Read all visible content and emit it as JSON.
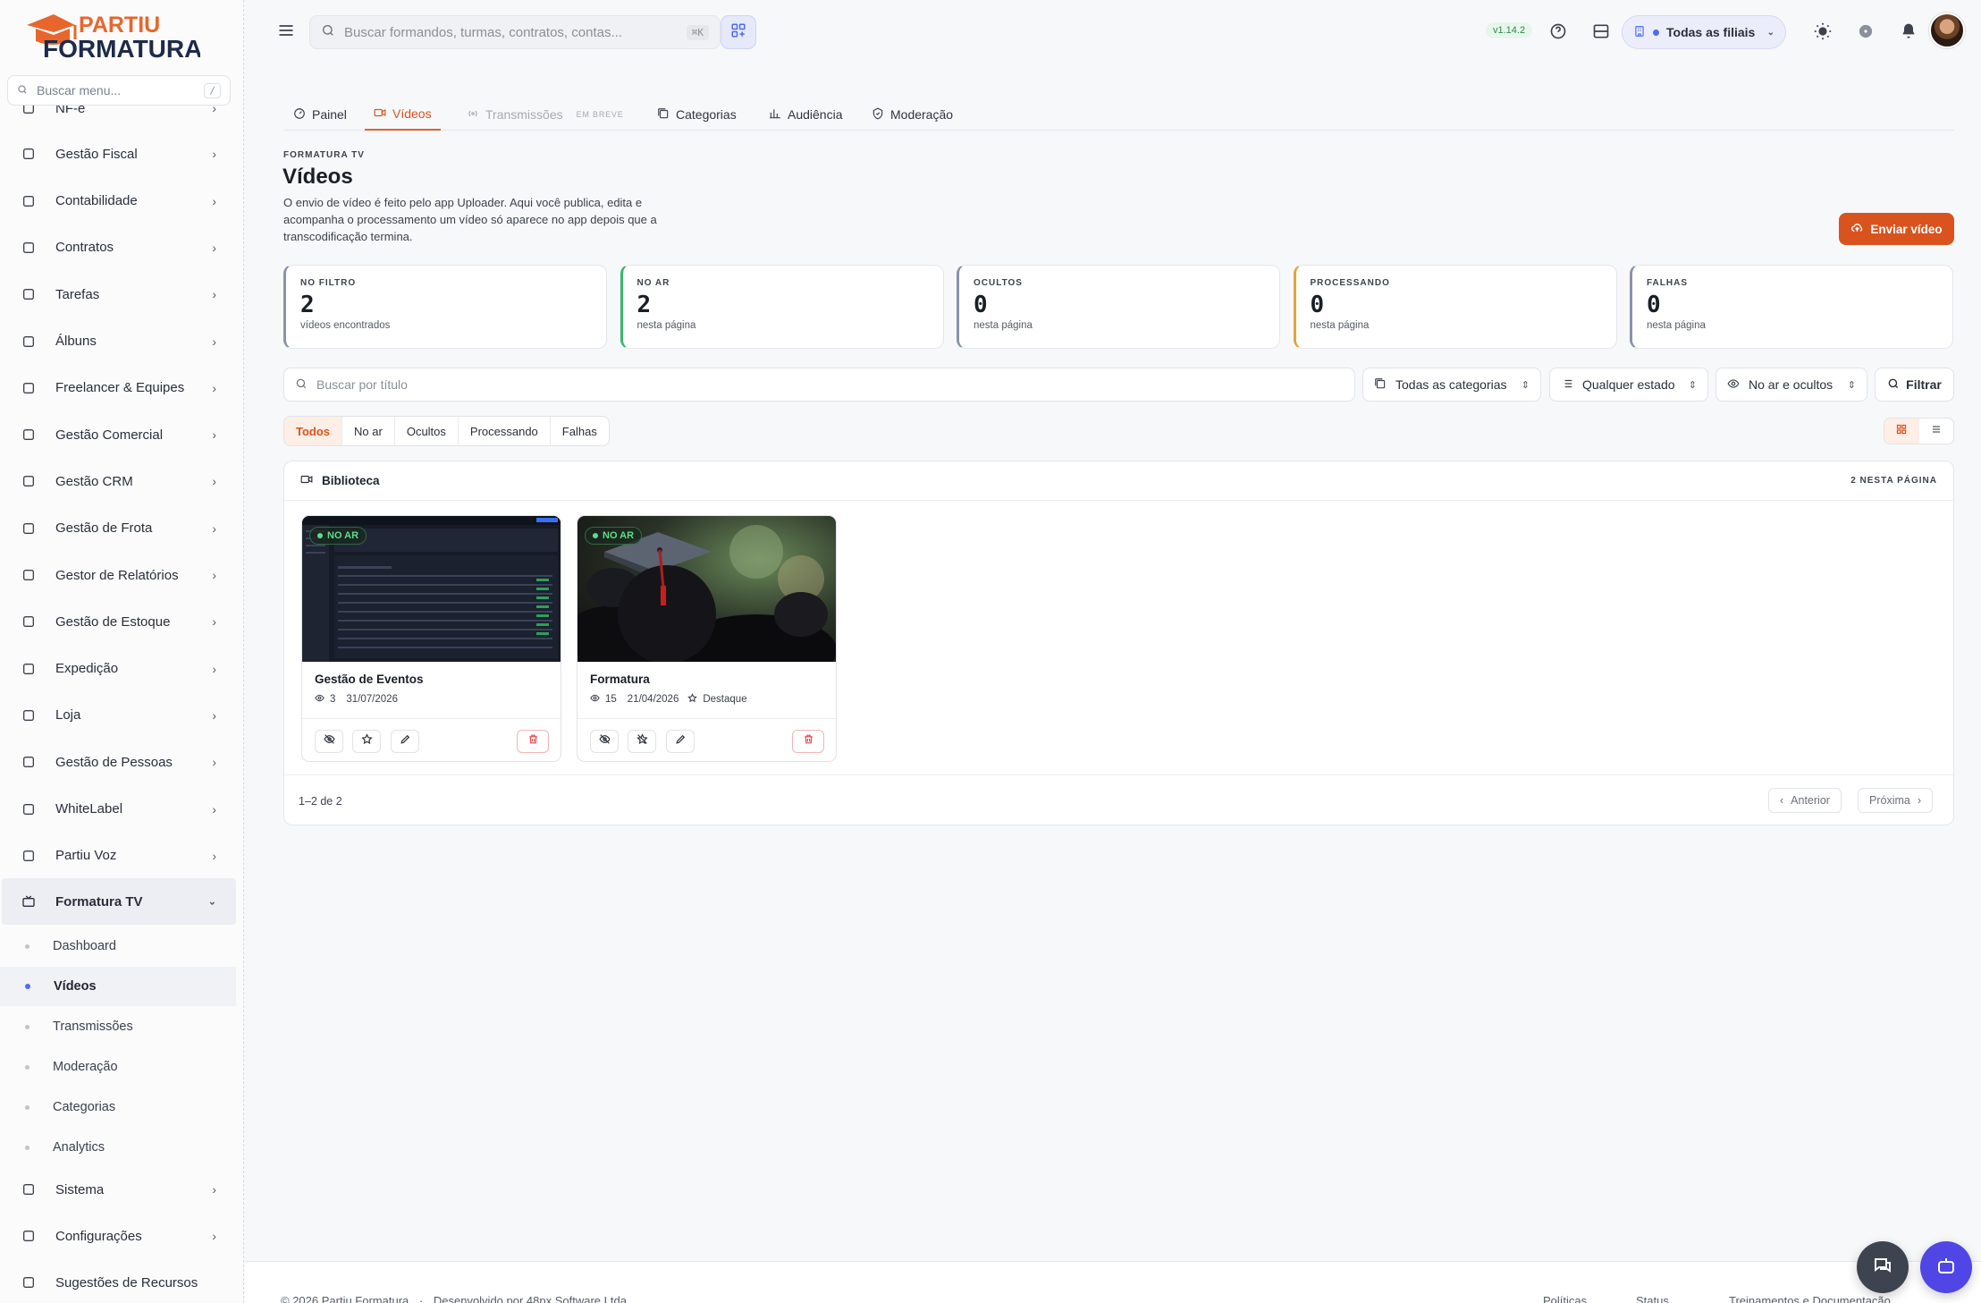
{
  "brand": {
    "line1": "PARTIU",
    "line2": "FORMATURA"
  },
  "menu_search": {
    "placeholder": "Buscar menu...",
    "shortcut": "/"
  },
  "nav": {
    "items": [
      {
        "label": "NF-e",
        "icon": "chevron-right-icon"
      },
      {
        "label": "Gestão Fiscal",
        "icon": "receipt-icon"
      },
      {
        "label": "Contabilidade",
        "icon": "book-icon"
      },
      {
        "label": "Contratos",
        "icon": "file-icon"
      },
      {
        "label": "Tarefas",
        "icon": "checkbox-icon"
      },
      {
        "label": "Álbuns",
        "icon": "album-icon"
      },
      {
        "label": "Freelancer & Equipes",
        "icon": "team-icon"
      },
      {
        "label": "Gestão Comercial",
        "icon": "briefcase-icon"
      },
      {
        "label": "Gestão CRM",
        "icon": "chart-icon"
      },
      {
        "label": "Gestão de Frota",
        "icon": "truck-icon"
      },
      {
        "label": "Gestor de Relatórios",
        "icon": "report-icon"
      },
      {
        "label": "Gestão de Estoque",
        "icon": "box-icon"
      },
      {
        "label": "Expedição",
        "icon": "package-icon"
      },
      {
        "label": "Loja",
        "icon": "cart-icon"
      },
      {
        "label": "Gestão de Pessoas",
        "icon": "users-icon"
      },
      {
        "label": "WhiteLabel",
        "icon": "palette-icon"
      },
      {
        "label": "Partiu Voz",
        "icon": "phone-icon"
      }
    ],
    "open_section": {
      "label": "Formatura TV",
      "icon": "tv-icon"
    },
    "sub_items": [
      {
        "label": "Dashboard"
      },
      {
        "label": "Vídeos"
      },
      {
        "label": "Transmissões"
      },
      {
        "label": "Moderação"
      },
      {
        "label": "Categorias"
      },
      {
        "label": "Analytics"
      }
    ],
    "bottom_items": [
      {
        "label": "Sistema",
        "icon": "layers-icon"
      },
      {
        "label": "Configurações",
        "icon": "gear-icon"
      },
      {
        "label": "Sugestões de Recursos",
        "icon": "lightbulb-icon"
      }
    ]
  },
  "topbar": {
    "search_placeholder": "Buscar formandos, turmas, contratos, contas...",
    "search_shortcut": "⌘K",
    "version": "v1.14.2",
    "branch": "Todas as filiais"
  },
  "tabs": [
    {
      "label": "Painel"
    },
    {
      "label": "Vídeos"
    },
    {
      "label": "Transmissões",
      "badge": "EM BREVE"
    },
    {
      "label": "Categorias"
    },
    {
      "label": "Audiência"
    },
    {
      "label": "Moderação"
    }
  ],
  "page": {
    "eyebrow": "FORMATURA TV",
    "title": "Vídeos",
    "description": "O envio de vídeo é feito pelo app Uploader. Aqui você publica, edita e acompanha o processamento um vídeo só aparece no app depois que a transcodificação termina.",
    "send_button": "Enviar vídeo"
  },
  "stats": [
    {
      "label": "NO FILTRO",
      "value": "2",
      "sub": "vídeos encontrados",
      "color": "#8a93a6"
    },
    {
      "label": "NO AR",
      "value": "2",
      "sub": "nesta página",
      "color": "#3cb371"
    },
    {
      "label": "OCULTOS",
      "value": "0",
      "sub": "nesta página",
      "color": "#8a93a6"
    },
    {
      "label": "PROCESSANDO",
      "value": "0",
      "sub": "nesta página",
      "color": "#e3a33b"
    },
    {
      "label": "FALHAS",
      "value": "0",
      "sub": "nesta página",
      "color": "#8a93a6"
    }
  ],
  "filters": {
    "search_placeholder": "Buscar por título",
    "category": "Todas as categorias",
    "state": "Qualquer estado",
    "visibility": "No ar e ocultos",
    "filter_button": "Filtrar"
  },
  "segments": [
    "Todos",
    "No ar",
    "Ocultos",
    "Processando",
    "Falhas"
  ],
  "library": {
    "title": "Biblioteca",
    "count": "2 NESTA PÁGINA",
    "videos": [
      {
        "title": "Gestão de Eventos",
        "status": "NO AR",
        "views": "3",
        "date": "31/07/2026",
        "featured": ""
      },
      {
        "title": "Formatura",
        "status": "NO AR",
        "views": "15",
        "date": "21/04/2026",
        "featured": "Destaque"
      }
    ],
    "range": "1–2 de 2",
    "prev": "Anterior",
    "next": "Próxima"
  },
  "footer": {
    "copyright": "© 2026 Partiu Formatura",
    "developed": "Desenvolvido por 48px Software Ltda",
    "links": [
      "Políticas",
      "Status",
      "Treinamentos e Documentação"
    ]
  },
  "colors": {
    "accent": "#d9531e",
    "primary": "#4f6bed",
    "success": "#3cb371"
  }
}
